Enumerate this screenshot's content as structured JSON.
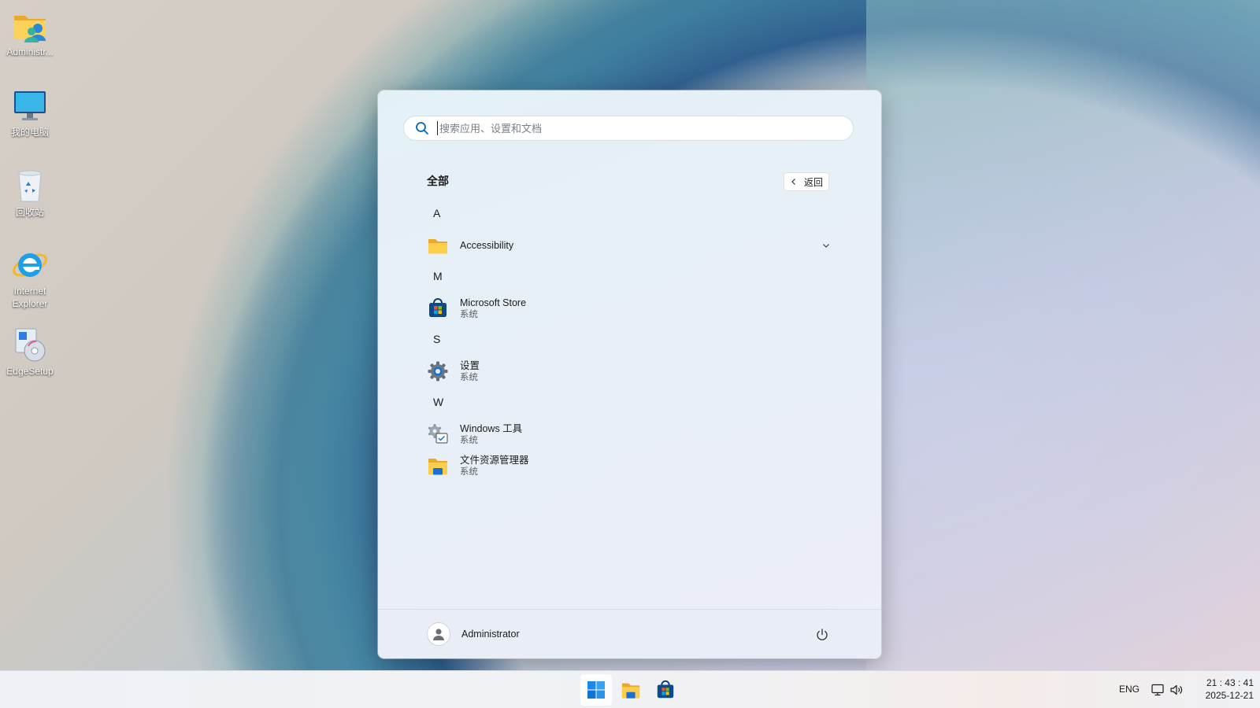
{
  "desktop": {
    "icons": [
      {
        "label": "Administr...",
        "icon": "user-folder-icon"
      },
      {
        "label": "我的电脑",
        "icon": "computer-icon"
      },
      {
        "label": "回收站",
        "icon": "recycle-bin-icon"
      },
      {
        "label": "Internet Explorer",
        "icon": "internet-explorer-icon"
      },
      {
        "label": "EdgeSetup",
        "icon": "edge-setup-icon"
      }
    ]
  },
  "start_menu": {
    "search": {
      "placeholder": "搜索应用、设置和文档"
    },
    "section_title": "全部",
    "back_label": "返回",
    "groups": [
      {
        "letter": "A",
        "apps": [
          {
            "name": "Accessibility",
            "sub": "",
            "icon": "folder-icon",
            "expandable": true
          }
        ]
      },
      {
        "letter": "M",
        "apps": [
          {
            "name": "Microsoft Store",
            "sub": "系统",
            "icon": "microsoft-store-icon"
          }
        ]
      },
      {
        "letter": "S",
        "apps": [
          {
            "name": "设置",
            "sub": "系统",
            "icon": "settings-gear-icon"
          }
        ]
      },
      {
        "letter": "W",
        "apps": [
          {
            "name": "Windows 工具",
            "sub": "系统",
            "icon": "windows-tools-icon"
          },
          {
            "name": "文件资源管理器",
            "sub": "系统",
            "icon": "file-explorer-icon"
          }
        ]
      }
    ],
    "footer": {
      "user": "Administrator",
      "power_icon": "power-icon"
    }
  },
  "taskbar": {
    "apps": [
      {
        "name": "Start",
        "icon": "windows-start-icon",
        "active": true
      },
      {
        "name": "File Explorer",
        "icon": "file-explorer-icon",
        "active": false
      },
      {
        "name": "Microsoft Store",
        "icon": "microsoft-store-icon",
        "active": false
      }
    ],
    "tray": {
      "language": "ENG",
      "network_icon": "network-icon",
      "volume_icon": "volume-icon",
      "time": "21 : 43 : 41",
      "date": "2025-12-21"
    }
  },
  "colors": {
    "accent": "#0067c0",
    "start_menu_bg": "#e8eff7",
    "folder_yellow": "#f8c63a"
  }
}
